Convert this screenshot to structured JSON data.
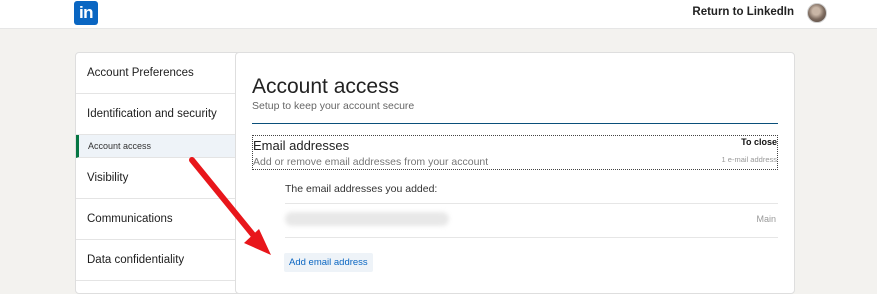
{
  "header": {
    "logo_text": "in",
    "return_link": "Return to LinkedIn"
  },
  "sidebar": {
    "items": [
      {
        "label": "Account Preferences"
      },
      {
        "label": "Identification and security"
      },
      {
        "label": "Account access"
      },
      {
        "label": "Visibility"
      },
      {
        "label": "Communications"
      },
      {
        "label": "Data confidentiality"
      }
    ]
  },
  "main": {
    "title": "Account access",
    "subtitle": "Setup to keep your account secure",
    "email_section": {
      "heading": "Email addresses",
      "description": "Add or remove email addresses from your account",
      "close_label": "To close",
      "count_label": "1 e-mail address"
    },
    "added_label": "The email addresses you added:",
    "email_row": {
      "tag": "Main"
    },
    "add_button": "Add email address"
  },
  "colors": {
    "brand": "#0a66c2",
    "active_marker": "#057642",
    "annotation_arrow": "#e8161b"
  }
}
